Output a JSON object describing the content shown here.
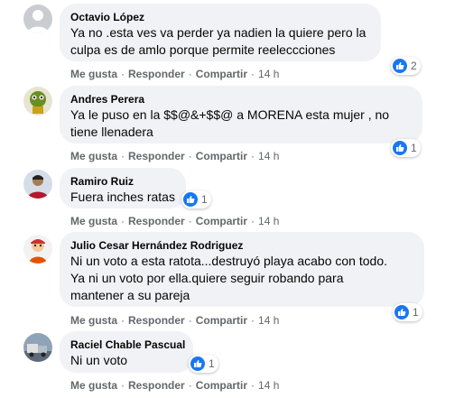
{
  "comments": [
    {
      "author": "Octavio López",
      "text": "Ya no .esta ves va perder ya nadien la quiere pero la\nculpa es de amlo porque permite reeleccciones",
      "reaction_count": "2",
      "actions": {
        "like": "Me gusta",
        "reply": "Responder",
        "share": "Compartir",
        "time": "14 h"
      },
      "avatar": "default-avatar-icon"
    },
    {
      "author": "Andres Perera",
      "text": "Ya le puso en la $$@&+$$@ a MORENA esta mujer , no\ntiene llenadera",
      "reaction_count": "1",
      "actions": {
        "like": "Me gusta",
        "reply": "Responder",
        "share": "Compartir",
        "time": "14 h"
      },
      "avatar": "character-avatar-icon"
    },
    {
      "author": "Ramiro Ruiz",
      "text": "Fuera inches ratas",
      "reaction_count": "1",
      "actions": {
        "like": "Me gusta",
        "reply": "Responder",
        "share": "Compartir",
        "time": "14 h"
      },
      "avatar": "person-avatar-icon"
    },
    {
      "author": "Julio Cesar Hernández Rodriguez",
      "text": "Ni un voto a esta ratota...destruyó playa acabo con todo.\nYa ni un voto por ella.quiere seguir robando para\nmantener a su pareja",
      "reaction_count": "1",
      "actions": {
        "like": "Me gusta",
        "reply": "Responder",
        "share": "Compartir",
        "time": "14 h"
      },
      "avatar": "cartoon-avatar-icon"
    },
    {
      "author": "Raciel Chable Pascual",
      "text": "Ni un voto",
      "reaction_count": "1",
      "actions": {
        "like": "Me gusta",
        "reply": "Responder",
        "share": "Compartir",
        "time": "14 h"
      },
      "avatar": "truck-avatar-icon"
    }
  ],
  "colors": {
    "bubble": "#f0f2f5",
    "like_blue": "#1877f2",
    "meta_text": "#65676b"
  }
}
